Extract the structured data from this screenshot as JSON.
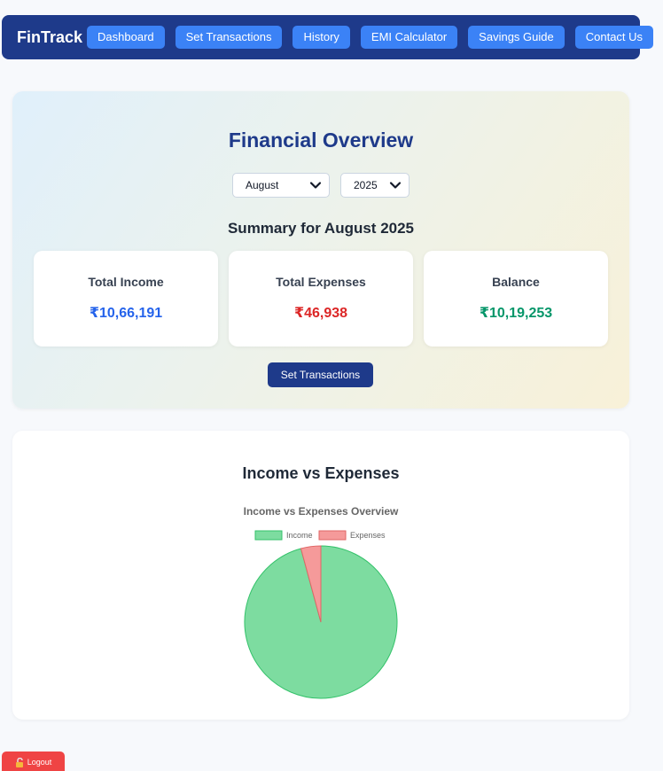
{
  "nav": {
    "brand": "FinTrack",
    "items": [
      {
        "label": "Dashboard"
      },
      {
        "label": "Set Transactions"
      },
      {
        "label": "History"
      },
      {
        "label": "EMI Calculator"
      },
      {
        "label": "Savings Guide"
      },
      {
        "label": "Contact Us"
      }
    ]
  },
  "overview": {
    "title": "Financial Overview",
    "month_select": "August",
    "year_select": "2025",
    "summary_title": "Summary for August 2025",
    "cards": {
      "income": {
        "label": "Total Income",
        "value": "₹10,66,191"
      },
      "expenses": {
        "label": "Total Expenses",
        "value": "₹46,938"
      },
      "balance": {
        "label": "Balance",
        "value": "₹10,19,253"
      }
    },
    "set_button": "Set Transactions"
  },
  "chart_section": {
    "heading": "Income vs Expenses"
  },
  "chart_data": {
    "type": "pie",
    "title": "Income vs Expenses Overview",
    "labels": [
      "Income",
      "Expenses"
    ],
    "values": [
      1066191,
      46938
    ],
    "colors": [
      "#7ddca0",
      "#f59a9a"
    ],
    "borders": [
      "#34c26a",
      "#e06666"
    ],
    "legend_position": "top"
  },
  "logout": {
    "label": "Logout",
    "icon": "unlock-icon"
  }
}
